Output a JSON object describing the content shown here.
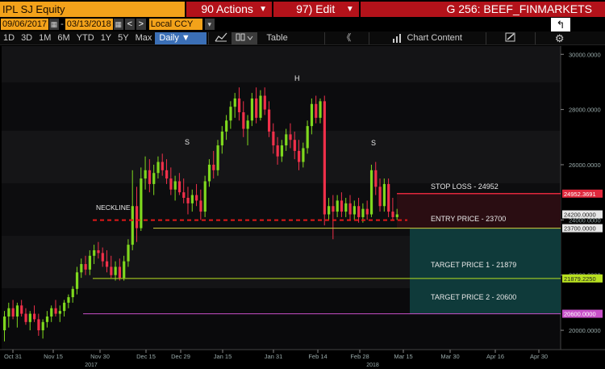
{
  "header": {
    "ticker": "IPL SJ Equity",
    "actions_label": "90 Actions",
    "edit_label": "97) Edit",
    "title": "G 256: BEEF_FINMARKETS"
  },
  "range": {
    "start_date": "09/06/2017",
    "dash": "-",
    "end_date": "03/13/2018",
    "prev": "<",
    "next": ">",
    "currency": "Local CCY"
  },
  "toolbar": {
    "periods": [
      "1D",
      "3D",
      "1M",
      "6M",
      "YTD",
      "1Y",
      "5Y",
      "Max"
    ],
    "interval": "Daily ▼",
    "table_label": "Table",
    "back_label": "《",
    "chart_content_label": "Chart Content"
  },
  "annotations": {
    "neckline": "NECKLINE",
    "s_left": "S",
    "head": "H",
    "s_right": "S",
    "stop_loss": "STOP LOSS - 24952",
    "entry": "ENTRY PRICE - 23700",
    "target1": "TARGET PRICE 1 - 21879",
    "target2": "TARGET PRICE 2 - 20600"
  },
  "price_tags": {
    "stop": "24952.3691",
    "last": "24200.0000",
    "entry": "23700.0000",
    "t1": "21879.2250",
    "t2": "20600.0000"
  },
  "colors": {
    "up": "#7fd81e",
    "down": "#f0304a",
    "stop": "#e0283c",
    "entry": "#d0d040",
    "t1": "#b8e020",
    "t2": "#c850c8",
    "neckline": "#e01818",
    "zone": "#0f3a3a"
  },
  "chart_data": {
    "type": "candlestick",
    "y_axis": {
      "ylim": [
        19300,
        30300
      ],
      "ticks": [
        "30000.0000",
        "28000.0000",
        "26000.0000",
        "24000.0000",
        "22000.0000",
        "20000.0000"
      ]
    },
    "x_axis": {
      "ticks": [
        "Oct 31",
        "Nov 15",
        "Nov 30",
        "Dec 15",
        "Dec 29",
        "Jan 15",
        "Jan 31",
        "Feb 14",
        "Feb 28",
        "Mar 15",
        "Mar 30",
        "Apr 16",
        "Apr 30"
      ],
      "years": [
        "2017",
        "2018"
      ]
    },
    "levels": {
      "stop": 24952,
      "neckline": 23990,
      "entry": 23700,
      "target1": 21879,
      "target2": 20600,
      "last": 24200
    },
    "candles": [
      {
        "o": 20000,
        "h": 20700,
        "l": 19600,
        "c": 20500
      },
      {
        "o": 20500,
        "h": 21000,
        "l": 20100,
        "c": 20800
      },
      {
        "o": 20800,
        "h": 21100,
        "l": 20400,
        "c": 20500
      },
      {
        "o": 20500,
        "h": 21000,
        "l": 20100,
        "c": 20900
      },
      {
        "o": 20900,
        "h": 21100,
        "l": 20500,
        "c": 20600
      },
      {
        "o": 20600,
        "h": 20800,
        "l": 20200,
        "c": 20300
      },
      {
        "o": 20300,
        "h": 20700,
        "l": 20000,
        "c": 20600
      },
      {
        "o": 20600,
        "h": 20900,
        "l": 20300,
        "c": 20400
      },
      {
        "o": 20400,
        "h": 20600,
        "l": 19800,
        "c": 20000
      },
      {
        "o": 20000,
        "h": 20400,
        "l": 19700,
        "c": 20300
      },
      {
        "o": 20300,
        "h": 20700,
        "l": 20100,
        "c": 20500
      },
      {
        "o": 20500,
        "h": 20900,
        "l": 20300,
        "c": 20800
      },
      {
        "o": 20800,
        "h": 21100,
        "l": 20500,
        "c": 20600
      },
      {
        "o": 20600,
        "h": 20900,
        "l": 20300,
        "c": 20700
      },
      {
        "o": 20700,
        "h": 21100,
        "l": 20500,
        "c": 21000
      },
      {
        "o": 21000,
        "h": 21300,
        "l": 20800,
        "c": 21200
      },
      {
        "o": 21200,
        "h": 21600,
        "l": 21000,
        "c": 21500
      },
      {
        "o": 21500,
        "h": 22300,
        "l": 21300,
        "c": 22100
      },
      {
        "o": 22100,
        "h": 22600,
        "l": 21900,
        "c": 22400
      },
      {
        "o": 22400,
        "h": 22700,
        "l": 22000,
        "c": 22200
      },
      {
        "o": 22200,
        "h": 22900,
        "l": 22000,
        "c": 22700
      },
      {
        "o": 22700,
        "h": 23100,
        "l": 22400,
        "c": 22900
      },
      {
        "o": 22900,
        "h": 23200,
        "l": 22600,
        "c": 22800
      },
      {
        "o": 22800,
        "h": 23000,
        "l": 22300,
        "c": 22500
      },
      {
        "o": 22500,
        "h": 22900,
        "l": 22100,
        "c": 22300
      },
      {
        "o": 22300,
        "h": 22700,
        "l": 21900,
        "c": 22000
      },
      {
        "o": 22000,
        "h": 22500,
        "l": 21800,
        "c": 22300
      },
      {
        "o": 22300,
        "h": 22600,
        "l": 21800,
        "c": 21900
      },
      {
        "o": 21900,
        "h": 22700,
        "l": 21800,
        "c": 22500
      },
      {
        "o": 22500,
        "h": 23300,
        "l": 22300,
        "c": 23100
      },
      {
        "o": 23100,
        "h": 25800,
        "l": 22900,
        "c": 24500
      },
      {
        "o": 24500,
        "h": 25200,
        "l": 23200,
        "c": 23700
      },
      {
        "o": 23700,
        "h": 25900,
        "l": 23600,
        "c": 25500
      },
      {
        "o": 25500,
        "h": 26300,
        "l": 25100,
        "c": 25800
      },
      {
        "o": 25800,
        "h": 26200,
        "l": 25000,
        "c": 25300
      },
      {
        "o": 25300,
        "h": 26000,
        "l": 24900,
        "c": 25700
      },
      {
        "o": 25700,
        "h": 26300,
        "l": 25500,
        "c": 26100
      },
      {
        "o": 26100,
        "h": 26400,
        "l": 25600,
        "c": 25800
      },
      {
        "o": 25800,
        "h": 26200,
        "l": 25300,
        "c": 25500
      },
      {
        "o": 25500,
        "h": 25900,
        "l": 24900,
        "c": 25100
      },
      {
        "o": 25100,
        "h": 25600,
        "l": 24700,
        "c": 25400
      },
      {
        "o": 25400,
        "h": 25700,
        "l": 24900,
        "c": 25000
      },
      {
        "o": 25000,
        "h": 25500,
        "l": 24600,
        "c": 24800
      },
      {
        "o": 24800,
        "h": 25200,
        "l": 24200,
        "c": 24600
      },
      {
        "o": 24600,
        "h": 25100,
        "l": 24300,
        "c": 24900
      },
      {
        "o": 24900,
        "h": 25300,
        "l": 24500,
        "c": 24700
      },
      {
        "o": 24700,
        "h": 25100,
        "l": 24000,
        "c": 24300
      },
      {
        "o": 24300,
        "h": 25600,
        "l": 24100,
        "c": 25400
      },
      {
        "o": 25400,
        "h": 26200,
        "l": 25200,
        "c": 26000
      },
      {
        "o": 26000,
        "h": 26500,
        "l": 25500,
        "c": 25800
      },
      {
        "o": 25800,
        "h": 26900,
        "l": 25600,
        "c": 26700
      },
      {
        "o": 26700,
        "h": 27400,
        "l": 26400,
        "c": 27200
      },
      {
        "o": 27200,
        "h": 27800,
        "l": 26900,
        "c": 27600
      },
      {
        "o": 27600,
        "h": 28300,
        "l": 27300,
        "c": 28100
      },
      {
        "o": 28100,
        "h": 28600,
        "l": 27700,
        "c": 28400
      },
      {
        "o": 28400,
        "h": 28800,
        "l": 27600,
        "c": 27900
      },
      {
        "o": 27900,
        "h": 28300,
        "l": 27000,
        "c": 27300
      },
      {
        "o": 27300,
        "h": 27800,
        "l": 26700,
        "c": 27600
      },
      {
        "o": 27600,
        "h": 28600,
        "l": 27400,
        "c": 28400
      },
      {
        "o": 28400,
        "h": 28800,
        "l": 27500,
        "c": 27700
      },
      {
        "o": 27700,
        "h": 28700,
        "l": 27600,
        "c": 28500
      },
      {
        "o": 28500,
        "h": 28800,
        "l": 27800,
        "c": 28000
      },
      {
        "o": 28000,
        "h": 28300,
        "l": 27000,
        "c": 27200
      },
      {
        "o": 27200,
        "h": 27500,
        "l": 26400,
        "c": 26700
      },
      {
        "o": 26700,
        "h": 27000,
        "l": 26000,
        "c": 26300
      },
      {
        "o": 26300,
        "h": 26900,
        "l": 26100,
        "c": 26700
      },
      {
        "o": 26700,
        "h": 27300,
        "l": 26500,
        "c": 27100
      },
      {
        "o": 27100,
        "h": 27500,
        "l": 26600,
        "c": 26900
      },
      {
        "o": 26900,
        "h": 27200,
        "l": 26200,
        "c": 26500
      },
      {
        "o": 26500,
        "h": 26900,
        "l": 25800,
        "c": 26100
      },
      {
        "o": 26100,
        "h": 26800,
        "l": 25900,
        "c": 26600
      },
      {
        "o": 26600,
        "h": 27600,
        "l": 26400,
        "c": 27400
      },
      {
        "o": 27400,
        "h": 28400,
        "l": 27100,
        "c": 28200
      },
      {
        "o": 28200,
        "h": 28500,
        "l": 27500,
        "c": 27700
      },
      {
        "o": 27700,
        "h": 28400,
        "l": 27500,
        "c": 28300
      },
      {
        "o": 28300,
        "h": 28500,
        "l": 23800,
        "c": 24200
      },
      {
        "o": 24200,
        "h": 24800,
        "l": 24000,
        "c": 24500
      },
      {
        "o": 24500,
        "h": 24900,
        "l": 23300,
        "c": 24300
      },
      {
        "o": 24300,
        "h": 24900,
        "l": 24100,
        "c": 24700
      },
      {
        "o": 24700,
        "h": 25000,
        "l": 24100,
        "c": 24300
      },
      {
        "o": 24300,
        "h": 24800,
        "l": 24100,
        "c": 24600
      },
      {
        "o": 24600,
        "h": 24900,
        "l": 24000,
        "c": 24200
      },
      {
        "o": 24200,
        "h": 24700,
        "l": 24000,
        "c": 24500
      },
      {
        "o": 24500,
        "h": 24800,
        "l": 23900,
        "c": 24100
      },
      {
        "o": 24100,
        "h": 24600,
        "l": 23900,
        "c": 24400
      },
      {
        "o": 24400,
        "h": 24700,
        "l": 24000,
        "c": 24200
      },
      {
        "o": 24200,
        "h": 26000,
        "l": 24100,
        "c": 25800
      },
      {
        "o": 25800,
        "h": 26100,
        "l": 24900,
        "c": 25200
      },
      {
        "o": 25200,
        "h": 25500,
        "l": 24300,
        "c": 24500
      },
      {
        "o": 24500,
        "h": 25500,
        "l": 24300,
        "c": 25300
      },
      {
        "o": 25300,
        "h": 25500,
        "l": 24100,
        "c": 24300
      },
      {
        "o": 24300,
        "h": 24800,
        "l": 24000,
        "c": 24100
      },
      {
        "o": 24100,
        "h": 24400,
        "l": 24000,
        "c": 24200
      }
    ]
  }
}
